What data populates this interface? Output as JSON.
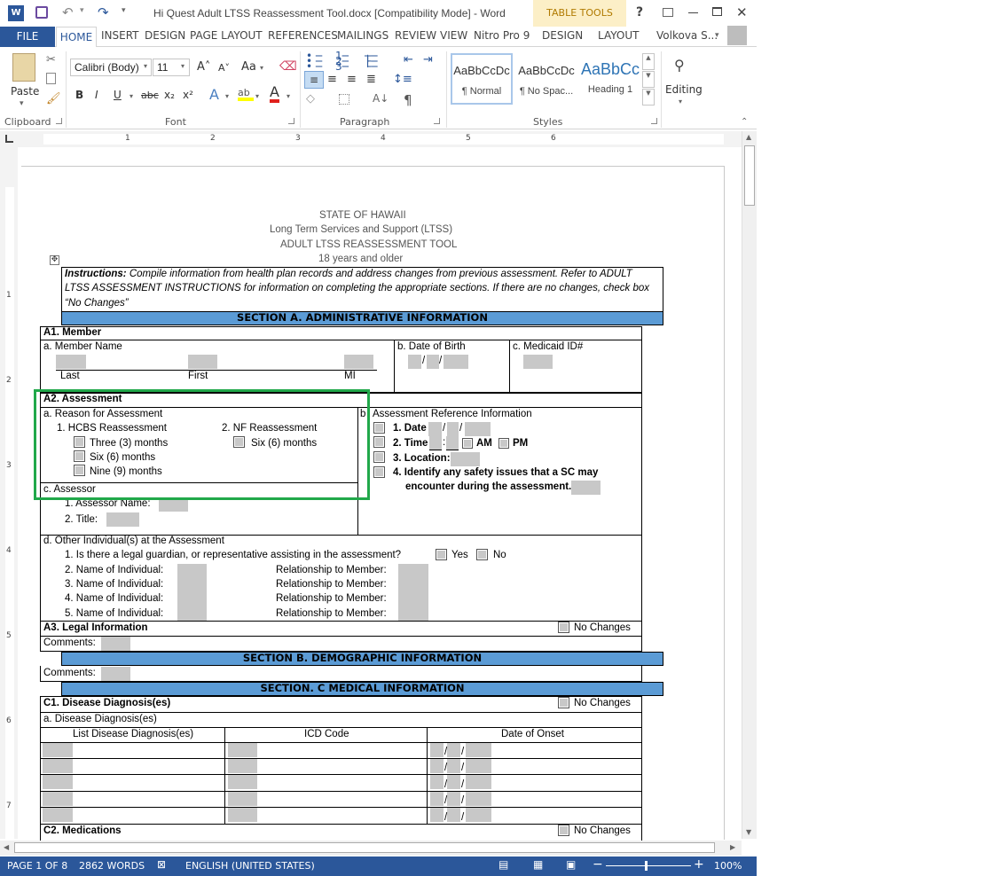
{
  "window": {
    "title": "Hi Quest Adult LTSS Reassessment Tool.docx [Compatibility Mode] - Word",
    "contextual_group": "TABLE TOOLS",
    "help": "?",
    "user": "Volkova S..."
  },
  "tabs": [
    "FILE",
    "HOME",
    "INSERT",
    "DESIGN",
    "PAGE LAYOUT",
    "REFERENCES",
    "MAILINGS",
    "REVIEW",
    "VIEW",
    "Nitro Pro 9",
    "DESIGN",
    "LAYOUT"
  ],
  "ribbon": {
    "clipboard": {
      "label": "Clipboard",
      "paste": "Paste"
    },
    "font": {
      "label": "Font",
      "name": "Calibri (Body)",
      "size": "11",
      "bold": "B",
      "italic": "I",
      "underline": "U",
      "strike": "abc",
      "sub": "x₂",
      "sup": "x²",
      "grow": "A˄",
      "shrink": "A˅",
      "case": "Aa",
      "color_a": "A"
    },
    "paragraph": {
      "label": "Paragraph",
      "pilcrow": "¶"
    },
    "styles": {
      "label": "Styles",
      "items": [
        {
          "preview": "AaBbCcDc",
          "name": "¶ Normal"
        },
        {
          "preview": "AaBbCcDc",
          "name": "¶ No Spac..."
        },
        {
          "preview": "AaBbCc",
          "name": "Heading 1"
        }
      ]
    },
    "editing": {
      "label": "Editing"
    }
  },
  "ruler": {
    "marks": [
      "1",
      "2",
      "3",
      "4",
      "5",
      "6"
    ],
    "vmarks": [
      "1",
      "2",
      "3",
      "4",
      "5",
      "6",
      "7"
    ]
  },
  "doc": {
    "header": [
      "STATE OF HAWAII",
      "Long Term Services and Support (LTSS)",
      "ADULT LTSS REASSESSMENT TOOL",
      "18 years and older"
    ],
    "instructions": {
      "lead": "Instructions:",
      "line1": "Compile information from health plan records and address changes from previous assessment. Refer to ADULT",
      "line2": "LTSS ASSESSMENT INSTRUCTIONS for information on completing the appropriate sections. If there are no changes, check box",
      "line3": "“No Changes”"
    },
    "sectionA": "SECTION A. ADMINISTRATIVE INFORMATION",
    "a1": {
      "title": "A1. Member",
      "member_name": "a. Member Name",
      "last": "Last",
      "first": "First",
      "mi": "MI",
      "dob": "b. Date of Birth",
      "medicaid": "c. Medicaid ID#"
    },
    "a2": {
      "title": "A2. Assessment",
      "reason": "a. Reason for Assessment",
      "hcbs": "1. HCBS Reassessment",
      "nf": "2. NF Reassessment",
      "three": "Three (3) months",
      "six": "Six (6) months",
      "nine": "Nine (9) months",
      "nf_six": "Six (6) months",
      "assessor": "c. Assessor",
      "assessor_name": "1.  Assessor Name:",
      "title_label": "2.  Title:",
      "b_label": "b",
      "ref": "Assessment Reference Information",
      "date": "1. Date",
      "time": "2. Time",
      "am": "AM",
      "pm": "PM",
      "location": "3. Location:",
      "safety1": "4. Identify any safety issues that a SC may",
      "safety2": "encounter during the assessment."
    },
    "d": {
      "title": "d. Other Individual(s) at the Assessment",
      "q1": "1.   Is there a legal guardian, or representative assisting in the assessment?",
      "yes": "Yes",
      "no": "No",
      "rows": [
        {
          "n": "2.  Name of Individual:",
          "r": "Relationship to Member:"
        },
        {
          "n": "3.  Name of Individual:",
          "r": "Relationship to Member:"
        },
        {
          "n": "4.  Name of Individual:",
          "r": "Relationship to Member:"
        },
        {
          "n": "5.  Name of Individual:",
          "r": "Relationship to Member:"
        }
      ]
    },
    "a3": {
      "title": "A3. Legal Information",
      "no_changes": "No Changes",
      "comments": "Comments:"
    },
    "sectionB": "SECTION B. DEMOGRAPHIC INFORMATION",
    "b_comments": "Comments:",
    "sectionC": "SECTION. C MEDICAL INFORMATION",
    "c1": {
      "title": "C1. Disease Diagnosis(es)",
      "no_changes": "No Changes",
      "sub": "a. Disease Diagnosis(es)",
      "col1": "List Disease Diagnosis(es)",
      "col2": "ICD Code",
      "col3": "Date of Onset"
    },
    "c2": {
      "title": "C2. Medications",
      "no_changes": "No Changes"
    }
  },
  "status": {
    "page": "PAGE 1 OF 8",
    "words": "2862 WORDS",
    "lang": "ENGLISH (UNITED STATES)",
    "zoom": "100%"
  }
}
